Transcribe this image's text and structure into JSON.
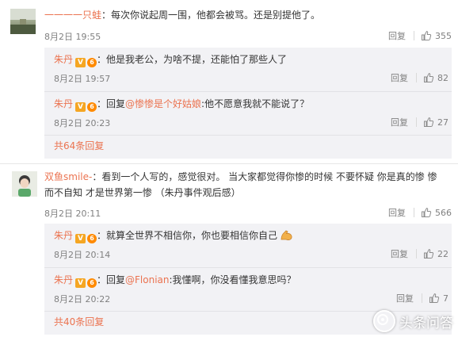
{
  "thread1": {
    "user": "一一一一只蛙",
    "text": "：每次你说起周一围，他都会被骂。还是别提他了。",
    "time": "8月2日 19:55",
    "reply_label": "回复",
    "likes": "355",
    "replies": [
      {
        "user": "朱丹",
        "badge_v": "V",
        "badge_level": "6",
        "text": "：他是我老公，为啥不提，还能怕了那些人了",
        "time": "8月2日 19:57",
        "reply_label": "回复",
        "likes": "82"
      },
      {
        "user": "朱丹",
        "badge_v": "V",
        "badge_level": "6",
        "prefix": "：回复",
        "mention": "@惨惨是个好姑娘",
        "text": ":他不愿意我就不能说了？",
        "time": "8月2日 20:23",
        "reply_label": "回复",
        "likes": "27"
      }
    ],
    "more": "共64条回复"
  },
  "thread2": {
    "user": "双鱼smile-",
    "text": "：看到一个人写的，感觉很对。 当大家都觉得你惨的时候 不要怀疑 你是真的惨 惨而不自知 才是世界第一惨 （朱丹事件观后感）",
    "time": "8月2日 20:11",
    "reply_label": "回复",
    "likes": "566",
    "replies": [
      {
        "user": "朱丹",
        "badge_v": "V",
        "badge_level": "6",
        "text": "：就算全世界不相信你，你也要相信你自己",
        "emoji": "flexed-biceps-icon",
        "time": "8月2日 20:14",
        "reply_label": "回复",
        "likes": "22"
      },
      {
        "user": "朱丹",
        "badge_v": "V",
        "badge_level": "6",
        "prefix": "：回复",
        "mention": "@Flonian",
        "text": ":我懂啊，你没看懂我意思吗？",
        "time": "8月2日 20:22",
        "reply_label": "回复",
        "likes": "7"
      }
    ],
    "more": "共40条回复"
  },
  "watermark": "头条问答",
  "colors": {
    "accent": "#eb7350",
    "meta": "#808080",
    "sub_bg": "#f2f2f5"
  }
}
